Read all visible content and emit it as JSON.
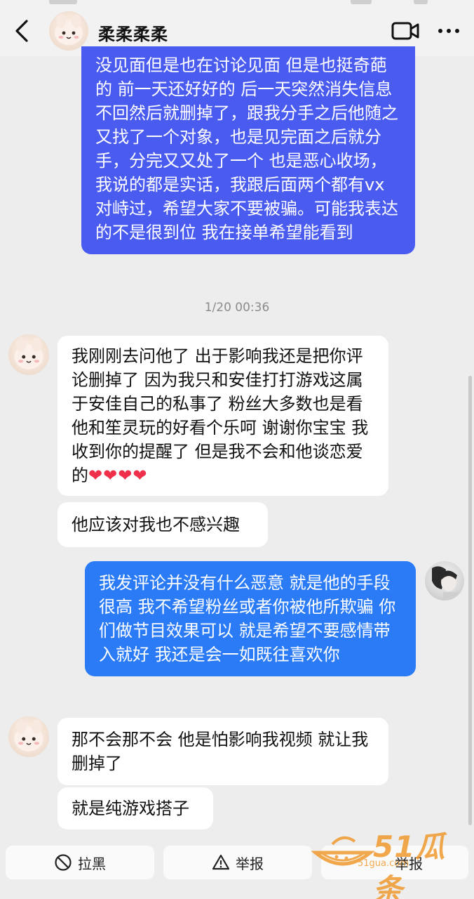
{
  "header": {
    "contact_name": "柔柔柔柔"
  },
  "icons": {
    "back": "chevron-left-icon",
    "video": "video-camera-icon",
    "more": "more-dots-icon",
    "block": "block-icon",
    "report": "warning-icon"
  },
  "colors": {
    "outgoing_purple": "#4a5bef",
    "outgoing_blue": "#2a7bf5",
    "incoming": "#ffffff",
    "background": "#ededed"
  },
  "messages": {
    "m1": "没见面但是也在讨论见面 但是也挺奇葩的 前一天还好好的 后一天突然消失信息不回然后就删掉了，跟我分手之后他随之又找了一个对象，也是见完面之后就分手，分完又又处了一个 也是恶心收场，我说的都是实话，我跟后面两个都有vx对峙过，希望大家不要被骗。可能我表达的不是很到位 我在接单希望能看到",
    "timestamp": "1/20 00:36",
    "m2": "我刚刚去问他了 出于影响我还是把你评论删掉了 因为我只和安佳打打游戏这属于安佳自己的私事了 粉丝大多数也是看他和笙灵玩的好看个乐呵 谢谢你宝宝 我收到你的提醒了 但是我不会和他谈恋爱的",
    "m2_hearts": "❤❤❤❤",
    "m3": "他应该对我也不感兴趣",
    "m4": "我发评论并没有什么恶意 就是他的手段很高 我不希望粉丝或者你被他所欺骗 你们做节目效果可以 就是希望不要感情带入就好 我还是会一如既往喜欢你",
    "m5": "那不会那不会 他是怕影响我视频 就让我删掉了",
    "m6": "就是纯游戏搭子"
  },
  "bottom": {
    "block_label": "拉黑",
    "report_label": "举报",
    "third_label": "举报"
  },
  "watermark": {
    "brand": "51瓜条",
    "url": "51gua.com"
  }
}
